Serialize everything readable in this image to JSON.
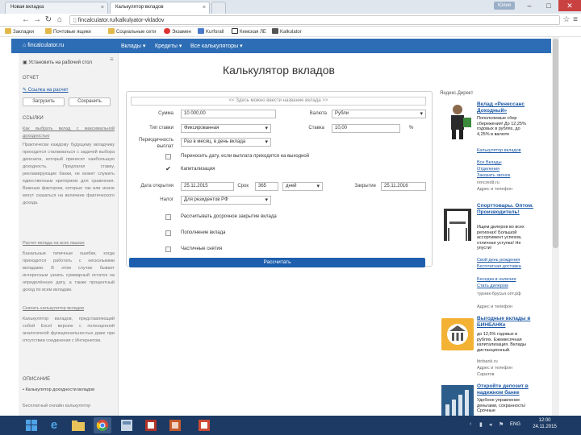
{
  "browser": {
    "tabs": [
      {
        "label": "Новая вкладка",
        "active": false
      },
      {
        "label": "Калькулятор вкладов",
        "active": true
      }
    ],
    "user_badge": "Юлия",
    "win": {
      "min": "–",
      "max": "□",
      "close": "✕"
    },
    "address": "fincalculator.ru/kalkulyator-vkladov",
    "bookmarks": [
      "Закладки",
      "Почтовые ящики",
      "Социальные сети",
      "Экзамен",
      "Kurforall",
      "Кемская ЛЕ",
      "Kalkulator"
    ]
  },
  "site_nav": {
    "logo": "fincalculator.ru",
    "items": [
      "Вклады ▾",
      "Кредиты ▾",
      "Все калькуляторы ▾"
    ]
  },
  "sidebar": {
    "home_link": "Установить на рабочий стол",
    "report_label": "ОТЧЕТ",
    "save_link": "Ссылка на расчет",
    "load_button": "Загрузить",
    "save_button": "Сохранить",
    "links_header": "ССЫЛКИ",
    "link1": "Как выбрать вклад с максимальной доходностью",
    "para1": "Практически каждому будущему вкладчику приходится сталкиваться с задачей выбора депозита, который принесет наибольшую доходность. Предлагая ставку, рекламирующие банки, не может служить единственным критерием для сравнения. Важным фактором, которые так или иначе могут сказаться на величине фактического дохода.",
    "link2": "Расчет вклада на всех языках",
    "para2": "Банальные типичные ошибки, когда приходится работать с несколькими вкладами. В этом случае бывает интересным узнать суммарный остаток на определённую дату, а также процентный доход по всем вкладам.",
    "link3": "Скачать калькулятор вкладов",
    "para3": "Калькулятор вкладов, представляющий собой Excel версию с полноценной аналогичной функциональностью даже при отсутствии соединения с Интернетом.",
    "desc_header": "ОПИСАНИЕ",
    "bullet1": "• Калькулятор доходности вкладов",
    "para4": "Бесплатный онлайн калькулятор"
  },
  "main": {
    "title": "Калькулятор вкладов",
    "form": {
      "search_placeholder": "<< Здесь можно ввести название вклада >>",
      "sum_label": "Сумма",
      "sum_value": "10 000,00",
      "currency_label": "Валюта",
      "currency_value": "Рубли",
      "rate_type_label": "Тип ставки",
      "rate_type_value": "Фиксированная",
      "rate_label": "Ставка",
      "rate_value": "10,00",
      "rate_unit": "%",
      "period_label": "Периодичность выплат",
      "period_value": "Раз в месяц, в день вклада",
      "weekend_label": "Переносить дату, если выплата приходится на выходной",
      "cap_label": "Капитализация",
      "open_label": "Дата открытия",
      "open_value": "25.11.2015",
      "term_label": "Срок",
      "term_value": "365",
      "term_unit": "дней",
      "close_label": "Закрытие",
      "close_value": "25.11.2016",
      "tax_label": "Налог",
      "tax_value": "Для резидентов РФ",
      "early_label": "Рассчитывать досрочное закрытие вклада",
      "topup_label": "Пополнение вклада",
      "partial_label": "Частичные снятия",
      "calc_button": "Рассчитать"
    }
  },
  "ads": {
    "header": "Яндекс.Директ",
    "ad1": {
      "title": "Вклад «Ренессанс Доходный»",
      "text": "Пополняемые сбер сбережения! До 12,25% годовых в рублях, до 4,25% в валюте",
      "links": [
        "Калькулятор вкладов",
        "Все Вклады",
        "Отделения",
        "Заказать звонок"
      ],
      "domain": "rencredit.ru",
      "contact": "Адрес и телефон"
    },
    "ad2": {
      "title": "Спорттовары. Оптом. Производитель!",
      "text": "Ищем дилеров во всех регионах! Большой ассортимент успехов, отличная уступка! Не упусти!",
      "links": [
        "Свой день рождения",
        "Бесплатная доставка",
        "Беседка в наличии",
        "Стать дилером"
      ],
      "domain": "турник-брусья опт.рф",
      "contact": "Адрес и телефон"
    },
    "ad3": {
      "title": "Выгодные вклады в БИНБАНКе",
      "text": "до 12,5% годовых в рублях. Ежемесячная капитализация. Вклады дистанционный.",
      "domain": "binbank.ru",
      "contact": "Адрес и телефон",
      "city": "Саратов"
    },
    "ad4": {
      "title": "Откройте депозит в надежном банке",
      "text": "Удобное управление деньгами, сохранность! Срочные"
    }
  },
  "taskbar": {
    "lang": "ENG",
    "time": "12:00",
    "date": "24.11.2015"
  },
  "colors": {
    "nav_blue": "#2d6db5",
    "button_blue": "#1d5fae",
    "taskbar": "#1c3a63",
    "link_blue": "#1a57a5"
  }
}
